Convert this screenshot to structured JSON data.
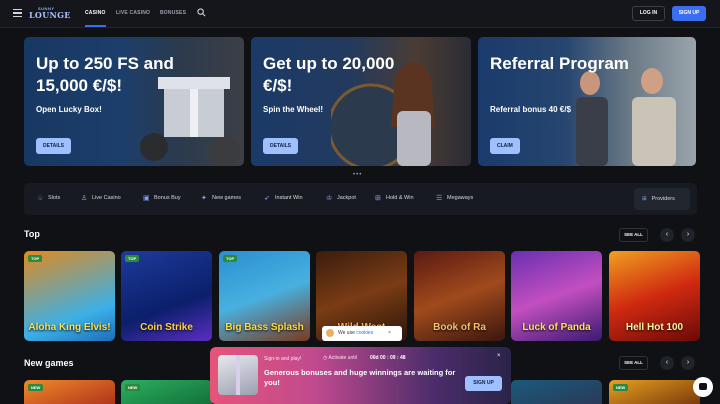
{
  "header": {
    "logo_small": "SUNNY",
    "logo_big": "LOUNGE",
    "nav": [
      "CASINO",
      "LIVE CASINO",
      "BONUSES"
    ],
    "login": "LOG IN",
    "signup": "SIGN UP"
  },
  "banners": [
    {
      "title": "Up to 250 FS and 15,000 €/$!",
      "subtitle": "Open Lucky Box!",
      "button": "DETAILS"
    },
    {
      "title": "Get up to 20,000 €/$!",
      "subtitle": "Spin the Wheel!",
      "button": "DETAILS"
    },
    {
      "title": "Referral Program",
      "subtitle": "Referral bonus 40 €/$",
      "button": "CLAIM"
    }
  ],
  "dots": "•••",
  "categories": [
    {
      "label": "Slots",
      "icon": "slots-icon",
      "glyph": "♧"
    },
    {
      "label": "Live Casino",
      "icon": "person-icon",
      "glyph": "♙"
    },
    {
      "label": "Bonus Buy",
      "icon": "gift-icon",
      "glyph": "▣"
    },
    {
      "label": "New games",
      "icon": "spark-icon",
      "glyph": "✦"
    },
    {
      "label": "Instant Win",
      "icon": "rocket-icon",
      "glyph": "➶"
    },
    {
      "label": "Jackpot",
      "icon": "crown-icon",
      "glyph": "♔"
    },
    {
      "label": "Hold & Win",
      "icon": "grid-icon",
      "glyph": "⊞"
    },
    {
      "label": "Megaways",
      "icon": "stack-icon",
      "glyph": "☰"
    }
  ],
  "providers": "Providers",
  "sections": {
    "top": "Top",
    "new": "New games",
    "see_all": "SEE ALL"
  },
  "top_games": [
    {
      "tag": "TOP",
      "title": "Aloha King Elvis!"
    },
    {
      "tag": "TOP",
      "title": "Coin Strike"
    },
    {
      "tag": "TOP",
      "title": "Big Bass Splash"
    },
    {
      "tag": "",
      "title": "Wild West"
    },
    {
      "tag": "",
      "title": "Book of Ra"
    },
    {
      "tag": "",
      "title": "Luck of Panda"
    },
    {
      "tag": "",
      "title": "Hell Hot 100"
    }
  ],
  "new_tags": [
    "NEW",
    "NEW",
    "",
    "",
    "",
    "",
    "NEW"
  ],
  "popup": {
    "small": "Sign-in and play!",
    "activate": "Activate until",
    "time": "00d 00 : 09 : 48",
    "text": "Generous bonuses and huge winnings are waiting for you!",
    "button": "SIGN UP",
    "close": "×"
  },
  "cookie": {
    "text": "We use ",
    "link": "cookies",
    "close": "×"
  },
  "colors": {
    "accent": "#3a6df0",
    "tag_top": "#2b8a3e",
    "button_light": "#9fc0ff"
  }
}
